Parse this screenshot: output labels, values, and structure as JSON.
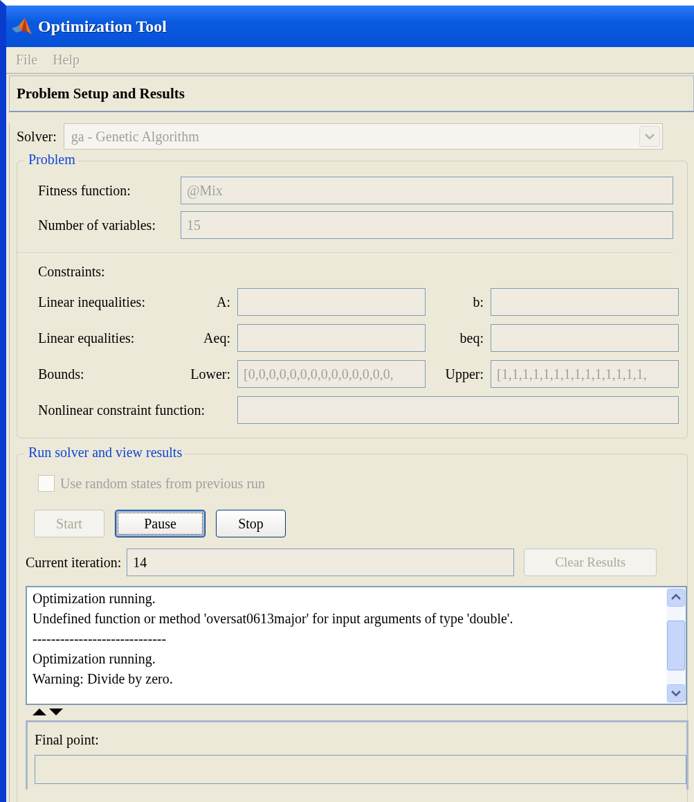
{
  "window": {
    "title": "Optimization Tool"
  },
  "menu": [
    {
      "label": "File",
      "disabled": true
    },
    {
      "label": "Help",
      "disabled": true
    }
  ],
  "panel": {
    "title": "Problem Setup and Results"
  },
  "solver": {
    "label": "Solver:",
    "value": "ga - Genetic Algorithm",
    "disabled": true
  },
  "problem": {
    "title": "Problem",
    "fields": [
      {
        "label": "Fitness function:",
        "value": "@Mix",
        "disabled": true
      },
      {
        "label": "Number of variables:",
        "value": "15",
        "disabled": true
      }
    ]
  },
  "constraints": {
    "title": "Constraints:",
    "rows": [
      {
        "label": "Linear inequalities:",
        "left_label": "A:",
        "right_label": "b:"
      },
      {
        "label": "Linear equalities:",
        "left_label": "Aeq:",
        "right_label": "beq:"
      },
      {
        "label": "Bounds:",
        "left_label": "Lower:",
        "left_value": "[0,0,0,0,0,0,0,0,0,0,0,0,0,0,",
        "right_label": "Upper:",
        "right_value": "[1,1,1,1,1,1,1,1,1,1,1,1,1,1,",
        "disabled": true
      }
    ],
    "nonlinear": {
      "label": "Nonlinear constraint function:"
    }
  },
  "run": {
    "title": "Run solver and view results",
    "checkbox": {
      "label": "Use random states from previous run",
      "checked": false,
      "disabled": true
    },
    "buttons": [
      {
        "label": "Start",
        "disabled": true,
        "focused": false
      },
      {
        "label": "Pause",
        "disabled": false,
        "focused": true
      },
      {
        "label": "Stop",
        "disabled": false,
        "focused": false
      }
    ],
    "iteration": {
      "label": "Current iteration:",
      "value": "14"
    },
    "clear_button": {
      "label": "Clear Results",
      "disabled": true
    },
    "log": [
      "Optimization running.",
      "Undefined function or method 'oversat0613major' for input arguments of type 'double'.",
      "-----------------------------",
      "Optimization running.",
      "Warning: Divide by zero."
    ]
  },
  "final_point": {
    "label": "Final point:"
  }
}
